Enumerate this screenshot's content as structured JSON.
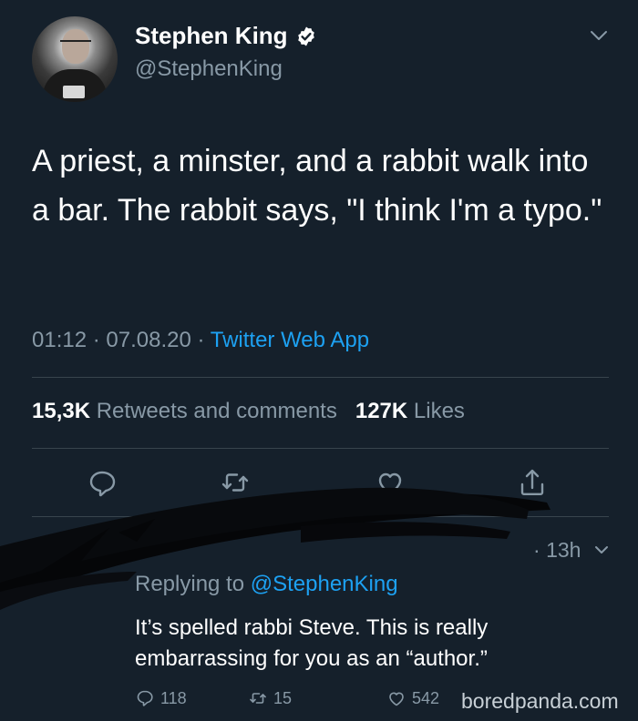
{
  "tweet": {
    "display_name": "Stephen King",
    "handle": "@StephenKing",
    "text": "A priest, a minster, and a rabbit walk into a bar. The rabbit says, \"I think I'm a typo.\"",
    "time": "01:12",
    "date": "07.08.20",
    "source": "Twitter Web App",
    "retweets_count": "15,3K",
    "retweets_label": "Retweets and comments",
    "likes_count": "127K",
    "likes_label": "Likes"
  },
  "reply": {
    "time": "13h",
    "replying_label": "Replying to",
    "replying_to": "@StephenKing",
    "text": "It’s spelled rabbi Steve. This is really embarrassing for you as an “author.”",
    "reply_count": "118",
    "retweet_count": "15",
    "like_count": "542"
  },
  "watermark": "boredpanda.com",
  "icons": {
    "verified": "verified-badge-icon",
    "caret": "chevron-down-icon",
    "reply": "reply-bubble-icon",
    "retweet": "retweet-icon",
    "like": "heart-icon",
    "share": "share-icon"
  },
  "colors": {
    "background": "#15202b",
    "primary_text": "#ffffff",
    "secondary_text": "#8899a6",
    "accent": "#1da1f2",
    "divider": "#38444d"
  }
}
